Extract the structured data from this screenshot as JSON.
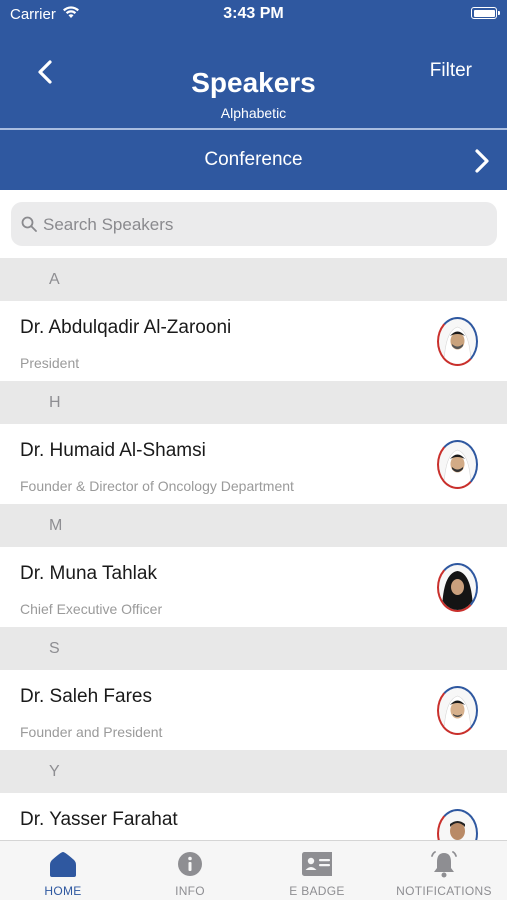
{
  "status_bar": {
    "carrier": "Carrier",
    "time": "3:43 PM"
  },
  "nav": {
    "title": "Speakers",
    "subtitle": "Alphabetic",
    "filter_label": "Filter",
    "back_icon": "chevron-left-icon"
  },
  "conference_bar": {
    "label": "Conference",
    "icon": "chevron-right-icon"
  },
  "search": {
    "placeholder": "Search Speakers",
    "icon": "search-icon"
  },
  "sections": [
    {
      "letter": "A",
      "speakers": [
        {
          "name": "Dr. Abdulqadir Al-Zarooni",
          "role": "President",
          "avatar": "male-ghutra"
        }
      ]
    },
    {
      "letter": "H",
      "speakers": [
        {
          "name": "Dr. Humaid Al-Shamsi",
          "role": "Founder & Director of Oncology Department",
          "avatar": "male-ghutra"
        }
      ]
    },
    {
      "letter": "M",
      "speakers": [
        {
          "name": "Dr. Muna Tahlak",
          "role": "Chief Executive Officer",
          "avatar": "female-shayla"
        }
      ]
    },
    {
      "letter": "S",
      "speakers": [
        {
          "name": "Dr. Saleh Fares",
          "role": "Founder and President",
          "avatar": "male-ghutra"
        }
      ]
    },
    {
      "letter": "Y",
      "speakers": [
        {
          "name": "Dr. Yasser Farahat",
          "role": "",
          "avatar": "male-suit"
        }
      ]
    }
  ],
  "tab_bar": {
    "tabs": [
      {
        "label": "HOME",
        "icon": "home-icon",
        "active": true
      },
      {
        "label": "INFO",
        "icon": "info-icon",
        "active": false
      },
      {
        "label": "E BADGE",
        "icon": "badge-icon",
        "active": false
      },
      {
        "label": "NOTIFICATIONS",
        "icon": "bell-icon",
        "active": false
      }
    ]
  },
  "colors": {
    "primary": "#2f58a0",
    "section_bg": "#e8e8e8",
    "tab_active": "#2f58a0",
    "tab_inactive": "#8e8e92"
  }
}
